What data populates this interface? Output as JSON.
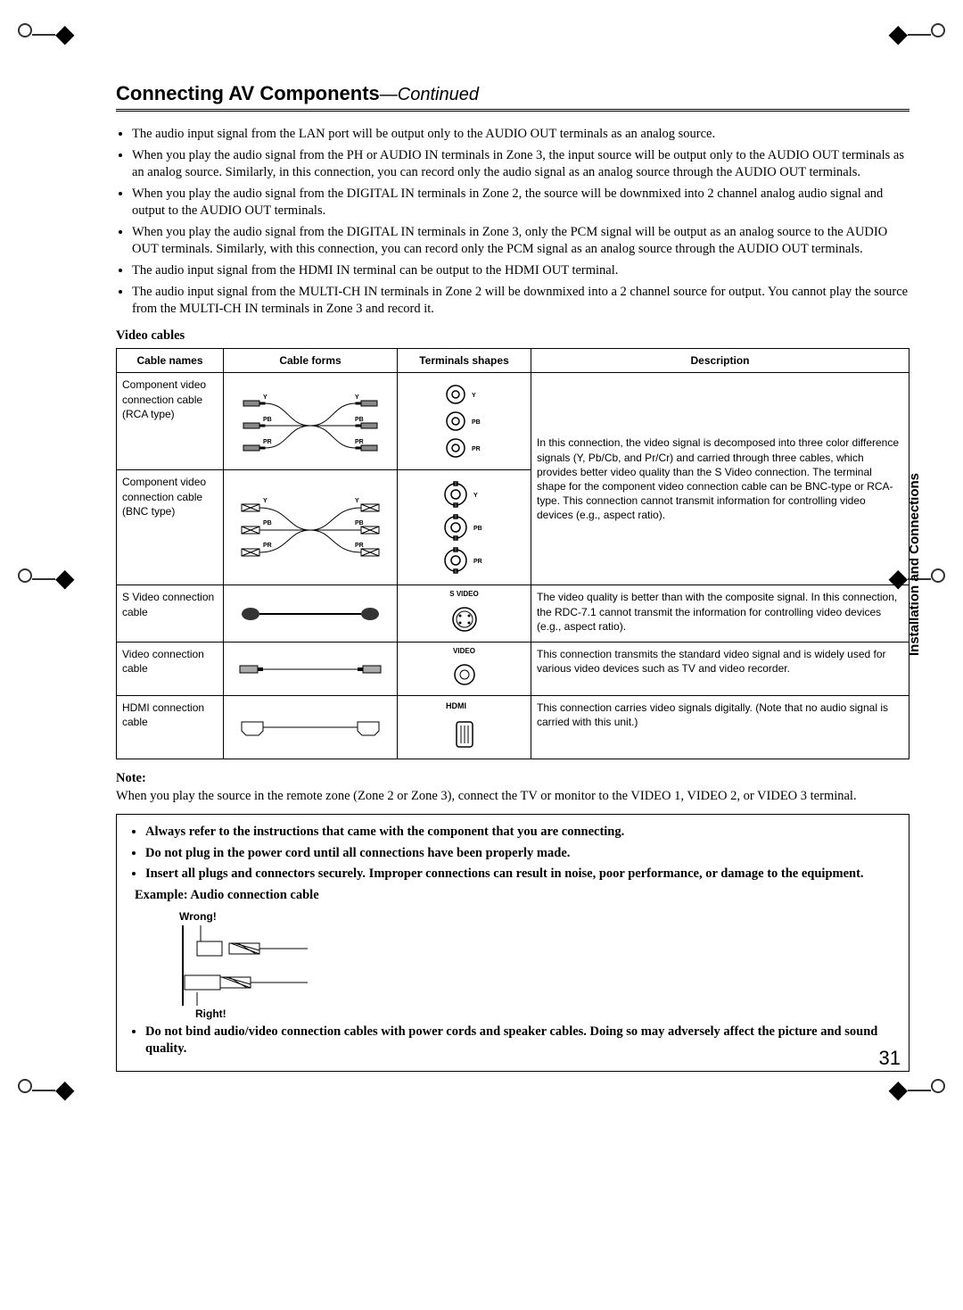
{
  "header": {
    "title": "Connecting AV Components",
    "subtitle": "—Continued"
  },
  "bullets": [
    "The audio input signal from the LAN port will be output only to the AUDIO OUT terminals as an analog source.",
    "When you play the audio signal from the PH or AUDIO IN terminals in Zone 3, the input source will be output only to the AUDIO OUT terminals as an analog source. Similarly, in this connection, you can record only the audio signal as an analog source through the AUDIO OUT terminals.",
    "When you play the audio signal from the DIGITAL IN terminals in Zone 2, the source will be downmixed into 2 channel analog audio signal and output to the AUDIO OUT terminals.",
    "When you play the audio signal from the DIGITAL IN terminals in Zone 3, only the PCM signal will be output as an analog source to the AUDIO OUT terminals. Similarly, with this connection, you can record only the PCM signal as an analog source through the AUDIO OUT terminals.",
    "The audio input signal from the HDMI IN terminal can be output to the HDMI OUT terminal.",
    "The audio input signal from the MULTI-CH IN terminals in Zone 2 will be downmixed into a 2 channel source for output. You cannot play the source from the MULTI-CH IN terminals in Zone 3 and record it."
  ],
  "video_cables_title": "Video cables",
  "table": {
    "headers": [
      "Cable names",
      "Cable forms",
      "Terminals shapes",
      "Description"
    ],
    "rows": [
      {
        "name": "Component video connection cable (RCA type)",
        "form_labels": [
          "Y",
          "PB",
          "PR"
        ],
        "terminal_labels": [
          "Y",
          "PB",
          "PR"
        ],
        "terminal_type": "rca_triple",
        "desc_slot": 0
      },
      {
        "name": "Component video connection cable (BNC type)",
        "form_labels": [
          "Y",
          "PB",
          "PR"
        ],
        "terminal_labels": [
          "Y",
          "PB",
          "PR"
        ],
        "terminal_type": "bnc_triple",
        "desc_slot": 0
      },
      {
        "name": "S Video connection cable",
        "terminal_label": "S VIDEO",
        "terminal_type": "svideo",
        "desc": "The video quality is better than with the composite signal. In this connection, the RDC-7.1 cannot transmit the information for controlling video devices (e.g., aspect ratio)."
      },
      {
        "name": "Video connection cable",
        "terminal_label": "VIDEO",
        "terminal_type": "rca_single",
        "desc": "This connection transmits the standard video signal and is widely used for various video devices such as TV and video recorder."
      },
      {
        "name": "HDMI connection cable",
        "terminal_type": "hdmi",
        "desc": "This connection carries video signals digitally. (Note that no audio signal is carried with this unit.)"
      }
    ],
    "component_desc": "In this connection, the video signal is decomposed into three color difference signals (Y, Pb/Cb, and Pr/Cr) and carried through three cables, which provides better video quality than the S Video connection.\nThe terminal shape for the component video connection cable can be BNC-type or RCA-type.\nThis connection cannot transmit information for controlling video devices (e.g., aspect ratio)."
  },
  "note_head": "Note:",
  "note_text": "When you play the source in the remote zone (Zone 2 or Zone 3), connect the TV or monitor to the VIDEO 1, VIDEO 2, or VIDEO 3 terminal.",
  "cautions": [
    "Always refer to the instructions that came with the component that you are connecting.",
    "Do not plug in the power cord until all connections have been properly made.",
    "Insert all plugs and connectors securely. Improper connections can result in noise, poor performance, or damage to the equipment.",
    "Do not bind audio/video connection cables with power cords and speaker cables. Doing so may adversely affect the picture and sound quality."
  ],
  "example_label": "Example: Audio connection cable",
  "wrong_label": "Wrong!",
  "right_label": "Right!",
  "side_tab": "Installation and Connections",
  "page_number": "31"
}
